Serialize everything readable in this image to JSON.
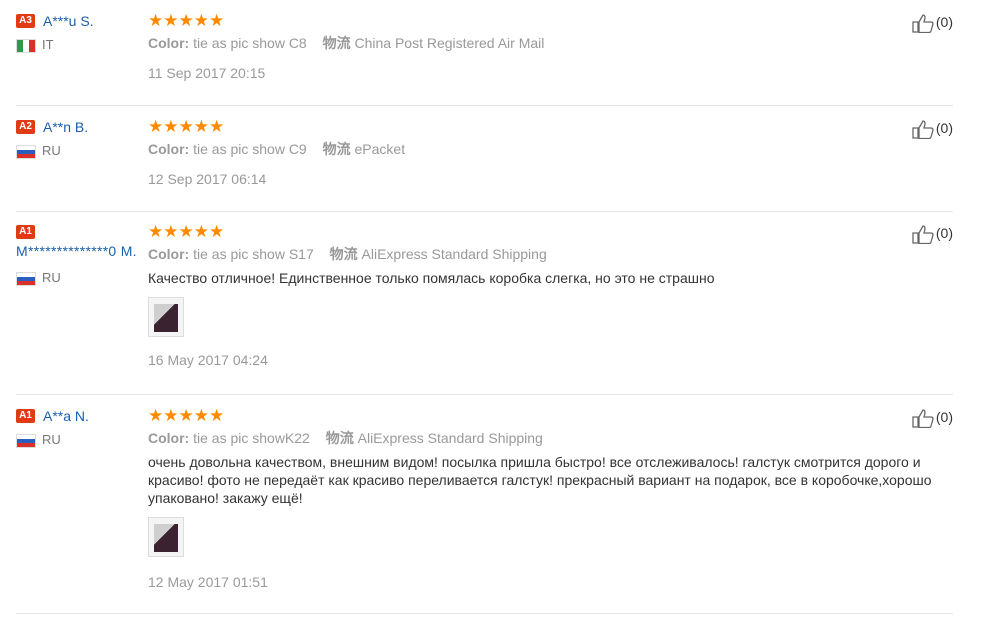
{
  "reviews": [
    {
      "level": "A3",
      "user": "A***u S.",
      "country": "IT",
      "flag": "italy",
      "stars": "★★★★★",
      "color_label": "Color:",
      "color_value": "tie as pic show C8",
      "logistics_label": "物流",
      "logistics_value": "China Post Registered Air Mail",
      "text": "",
      "has_photo": false,
      "date": "11 Sep 2017 20:15",
      "useful": "(0)"
    },
    {
      "level": "A2",
      "user": "A**n B.",
      "country": "RU",
      "flag": "russia",
      "stars": "★★★★★",
      "color_label": "Color:",
      "color_value": "tie as pic show C9",
      "logistics_label": "物流",
      "logistics_value": "ePacket",
      "text": "",
      "has_photo": false,
      "date": "12 Sep 2017 06:14",
      "useful": "(0)"
    },
    {
      "level": "A1",
      "user": "M**************0 M.",
      "country": "RU",
      "flag": "russia",
      "stars": "★★★★★",
      "color_label": "Color:",
      "color_value": "tie as pic show S17",
      "logistics_label": "物流",
      "logistics_value": "AliExpress Standard Shipping",
      "text": "Качество отличное! Единственное только помялась коробка слегка, но это не страшно",
      "has_photo": true,
      "date": "16 May 2017 04:24",
      "useful": "(0)"
    },
    {
      "level": "A1",
      "user": "A**a N.",
      "country": "RU",
      "flag": "russia",
      "stars": "★★★★★",
      "color_label": "Color:",
      "color_value": "tie as pic showK22",
      "logistics_label": "物流",
      "logistics_value": "AliExpress Standard Shipping",
      "text": "очень довольна качеством, внешним видом! посылка пришла быстро! все отслеживалось! галстук смотрится дорого и красиво! фото не передаёт как красиво переливается галстук! прекрасный вариант на подарок, все в коробочке,хорошо упаковано! закажу ещё!",
      "has_photo": true,
      "date": "12 May 2017 01:51",
      "useful": "(0)"
    }
  ],
  "colors": {
    "accent": "#1b5fab",
    "stars": "#ff8a00",
    "badge": "#e13b16"
  },
  "icons": {
    "like": "thumbs-up-icon"
  }
}
